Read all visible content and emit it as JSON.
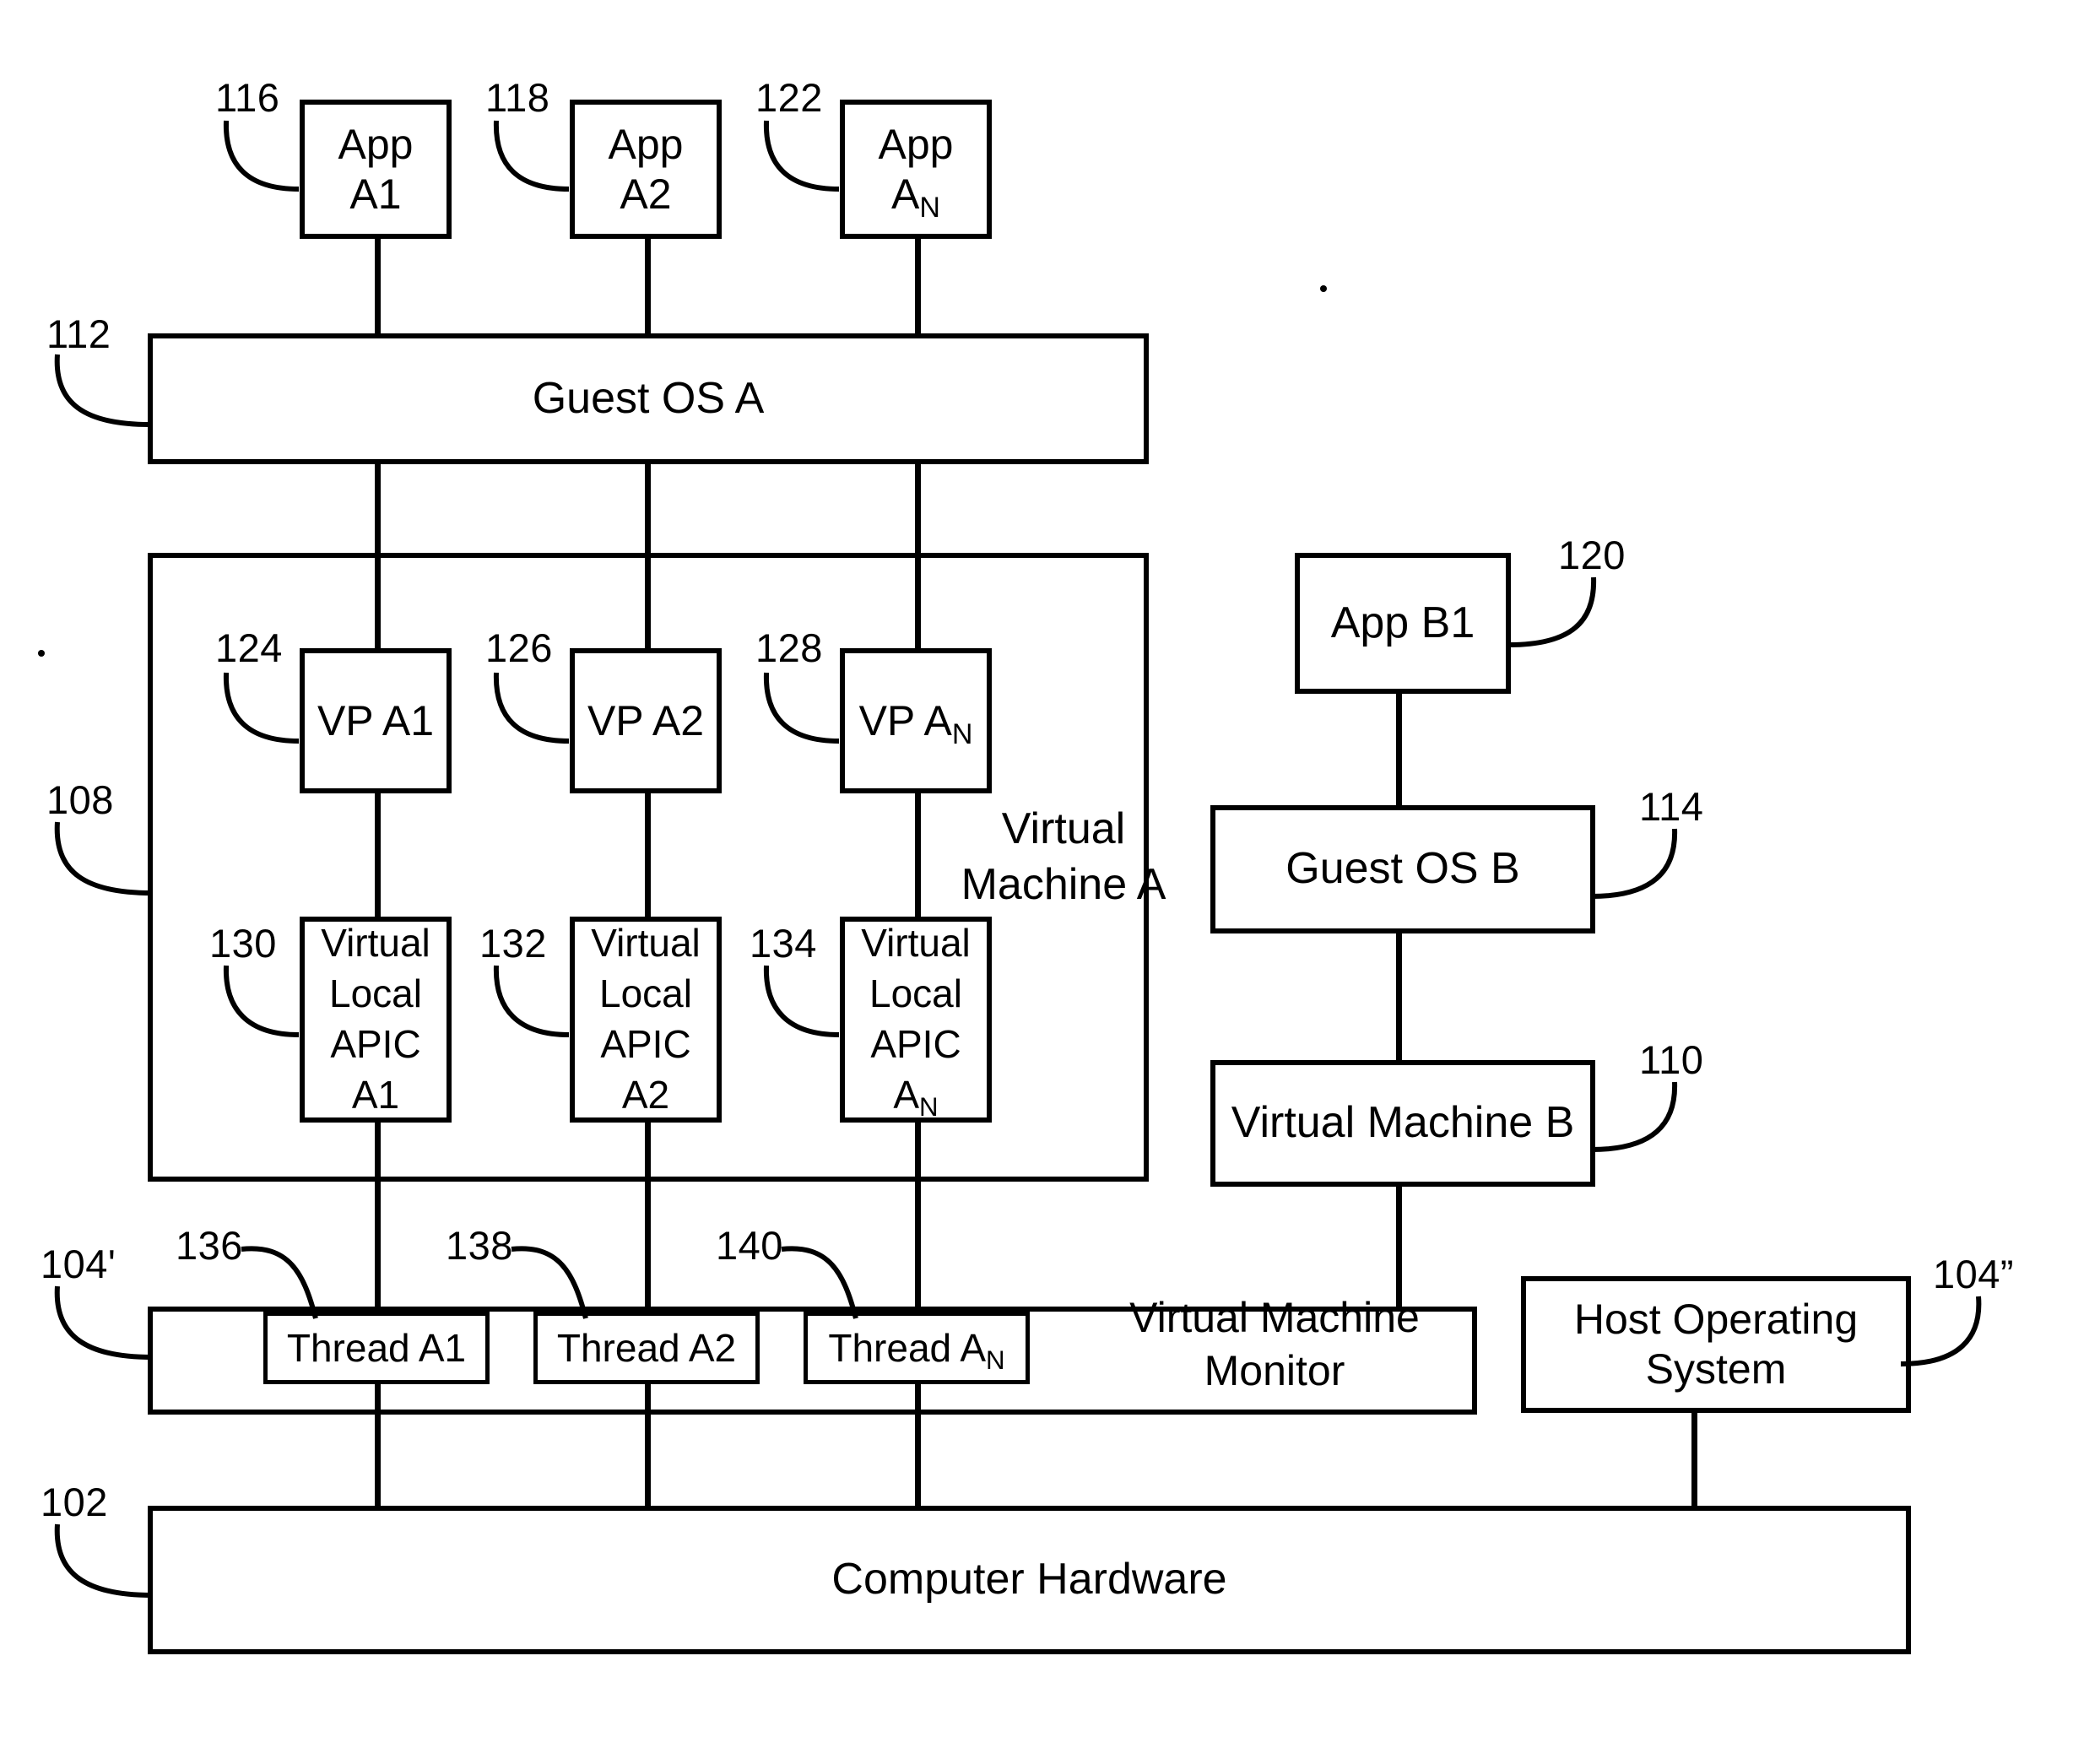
{
  "figure": {
    "type": "patent-block-diagram",
    "background": "#ffffff",
    "stroke": "#000000"
  },
  "apps_row": {
    "app_a1": {
      "line1": "App",
      "line2": "A1",
      "ref": "116"
    },
    "app_a2": {
      "line1": "App",
      "line2": "A2",
      "ref": "118"
    },
    "app_an": {
      "line1": "App",
      "line2": "A",
      "sub": "N",
      "ref": "122"
    }
  },
  "guest_os_a": {
    "label": "Guest OS A",
    "ref": "112"
  },
  "virtual_machine_a": {
    "ref": "108",
    "caption_line1": "Virtual",
    "caption_line2": "Machine A",
    "vps": [
      {
        "label": "VP A1",
        "ref": "124"
      },
      {
        "label": "VP A2",
        "ref": "126"
      },
      {
        "label": "VP A",
        "sub": "N",
        "ref": "128"
      }
    ],
    "apics": [
      {
        "l1": "Virtual",
        "l2": "Local",
        "l3": "APIC",
        "l4": "A1",
        "ref": "130"
      },
      {
        "l1": "Virtual",
        "l2": "Local",
        "l3": "APIC",
        "l4": "A2",
        "ref": "132"
      },
      {
        "l1": "Virtual",
        "l2": "Local",
        "l3": "APIC",
        "l4": "A",
        "sub": "N",
        "ref": "134"
      }
    ]
  },
  "right_stack": {
    "app_b1": {
      "label": "App B1",
      "ref": "120"
    },
    "guest_os_b": {
      "label": "Guest OS B",
      "ref": "114"
    },
    "virtual_machine_b": {
      "label": "Virtual Machine B",
      "ref": "110"
    }
  },
  "vmm_row": {
    "ref": "104'",
    "caption_line1": "Virtual Machine",
    "caption_line2": "Monitor",
    "threads": [
      {
        "label": "Thread A1",
        "ref": "136"
      },
      {
        "label": "Thread A2",
        "ref": "138"
      },
      {
        "label": "Thread A",
        "sub": "N",
        "ref": "140"
      }
    ]
  },
  "host_os": {
    "line1": "Host Operating",
    "line2": "System",
    "ref": "104”"
  },
  "computer_hardware": {
    "label": "Computer Hardware",
    "ref": "102"
  }
}
